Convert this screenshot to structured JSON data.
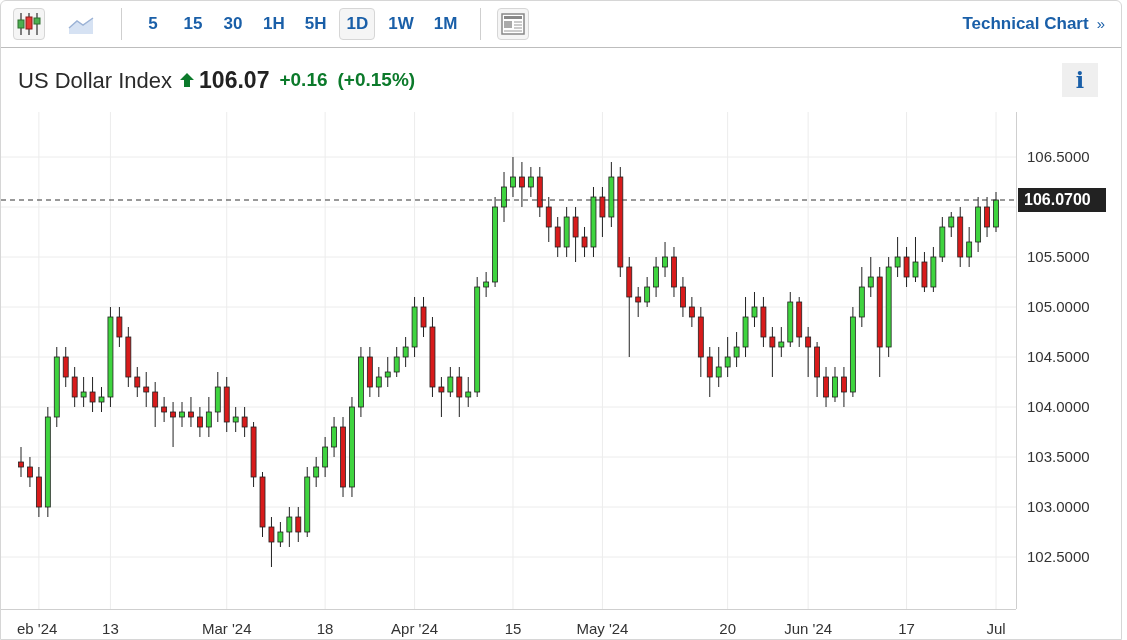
{
  "toolbar": {
    "chart_types": [
      {
        "kind": "candles",
        "selected": true
      },
      {
        "kind": "area",
        "selected": false
      }
    ],
    "intervals": [
      {
        "label": "5",
        "selected": false
      },
      {
        "label": "15",
        "selected": false
      },
      {
        "label": "30",
        "selected": false
      },
      {
        "label": "1H",
        "selected": false
      },
      {
        "label": "5H",
        "selected": false
      },
      {
        "label": "1D",
        "selected": true
      },
      {
        "label": "1W",
        "selected": false
      },
      {
        "label": "1M",
        "selected": false
      }
    ],
    "technical_chart_link": "Technical Chart",
    "link_arrow": "»"
  },
  "quote": {
    "name": "US Dollar Index",
    "rising": true,
    "price": "106.07",
    "change": "+0.16",
    "change_percent": "(+0.15%)",
    "info_button": "i"
  },
  "chart": {
    "current_price_label": "106.0700",
    "chart_data": {
      "type": "candlestick",
      "ylim": [
        101.98,
        106.95
      ],
      "grid": true,
      "ref_lines": [
        {
          "axis": "y",
          "value": 106.07
        }
      ],
      "categories": [
        null,
        null,
        "eb '24",
        null,
        null,
        null,
        null,
        null,
        null,
        null,
        "13",
        null,
        null,
        null,
        null,
        null,
        null,
        null,
        null,
        null,
        null,
        null,
        null,
        "Mar '24",
        null,
        null,
        null,
        null,
        null,
        null,
        null,
        null,
        null,
        null,
        "18",
        null,
        null,
        null,
        null,
        null,
        null,
        null,
        null,
        null,
        "Apr '24",
        null,
        null,
        null,
        null,
        null,
        null,
        null,
        null,
        null,
        null,
        "15",
        null,
        null,
        null,
        null,
        null,
        null,
        null,
        null,
        null,
        "May '24",
        null,
        null,
        null,
        null,
        null,
        null,
        null,
        null,
        null,
        null,
        null,
        null,
        null,
        "20",
        null,
        null,
        null,
        null,
        null,
        null,
        null,
        null,
        "Jun '24",
        null,
        null,
        null,
        null,
        null,
        null,
        null,
        null,
        null,
        null,
        "17",
        null,
        null,
        null,
        null,
        null,
        null,
        null,
        null,
        null,
        "Jul"
      ],
      "ohlc": [
        [
          103.45,
          103.6,
          103.3,
          103.4
        ],
        [
          103.4,
          103.5,
          103.2,
          103.3
        ],
        [
          103.3,
          103.4,
          102.9,
          103.0
        ],
        [
          103.0,
          104.0,
          102.9,
          103.9
        ],
        [
          103.9,
          104.6,
          103.8,
          104.5
        ],
        [
          104.5,
          104.6,
          104.2,
          104.3
        ],
        [
          104.3,
          104.4,
          104.0,
          104.1
        ],
        [
          104.1,
          104.3,
          104.0,
          104.15
        ],
        [
          104.15,
          104.3,
          103.95,
          104.05
        ],
        [
          104.05,
          104.2,
          103.95,
          104.1
        ],
        [
          104.1,
          105.0,
          104.0,
          104.9
        ],
        [
          104.9,
          105.0,
          104.6,
          104.7
        ],
        [
          104.7,
          104.8,
          104.2,
          104.3
        ],
        [
          104.3,
          104.4,
          104.1,
          104.2
        ],
        [
          104.2,
          104.35,
          104.0,
          104.15
        ],
        [
          104.15,
          104.25,
          103.8,
          104.0
        ],
        [
          104.0,
          104.1,
          103.85,
          103.95
        ],
        [
          103.95,
          104.05,
          103.6,
          103.9
        ],
        [
          103.9,
          104.05,
          103.8,
          103.95
        ],
        [
          103.95,
          104.1,
          103.8,
          103.9
        ],
        [
          103.9,
          104.0,
          103.7,
          103.8
        ],
        [
          103.8,
          104.1,
          103.7,
          103.95
        ],
        [
          103.95,
          104.35,
          103.85,
          104.2
        ],
        [
          104.2,
          104.3,
          103.75,
          103.85
        ],
        [
          103.85,
          104.0,
          103.75,
          103.9
        ],
        [
          103.9,
          104.0,
          103.7,
          103.8
        ],
        [
          103.8,
          103.85,
          103.2,
          103.3
        ],
        [
          103.3,
          103.35,
          102.7,
          102.8
        ],
        [
          102.8,
          102.9,
          102.4,
          102.65
        ],
        [
          102.65,
          102.85,
          102.6,
          102.75
        ],
        [
          102.75,
          103.0,
          102.6,
          102.9
        ],
        [
          102.9,
          103.0,
          102.65,
          102.75
        ],
        [
          102.75,
          103.4,
          102.7,
          103.3
        ],
        [
          103.3,
          103.5,
          103.2,
          103.4
        ],
        [
          103.4,
          103.7,
          103.3,
          103.6
        ],
        [
          103.6,
          103.9,
          103.5,
          103.8
        ],
        [
          103.8,
          103.9,
          103.1,
          103.2
        ],
        [
          103.2,
          104.1,
          103.1,
          104.0
        ],
        [
          104.0,
          104.6,
          103.9,
          104.5
        ],
        [
          104.5,
          104.6,
          104.1,
          104.2
        ],
        [
          104.2,
          104.4,
          104.1,
          104.3
        ],
        [
          104.3,
          104.5,
          104.2,
          104.35
        ],
        [
          104.35,
          104.6,
          104.3,
          104.5
        ],
        [
          104.5,
          104.7,
          104.4,
          104.6
        ],
        [
          104.6,
          105.1,
          104.5,
          105.0
        ],
        [
          105.0,
          105.1,
          104.7,
          104.8
        ],
        [
          104.8,
          104.9,
          104.1,
          104.2
        ],
        [
          104.2,
          104.3,
          103.9,
          104.15
        ],
        [
          104.15,
          104.4,
          104.1,
          104.3
        ],
        [
          104.3,
          104.4,
          103.9,
          104.1
        ],
        [
          104.1,
          104.3,
          104.0,
          104.15
        ],
        [
          104.15,
          105.3,
          104.1,
          105.2
        ],
        [
          105.2,
          105.35,
          105.1,
          105.25
        ],
        [
          105.25,
          106.1,
          105.2,
          106.0
        ],
        [
          106.0,
          106.35,
          105.85,
          106.2
        ],
        [
          106.2,
          106.5,
          106.1,
          106.3
        ],
        [
          106.3,
          106.45,
          106.0,
          106.2
        ],
        [
          106.2,
          106.4,
          106.1,
          106.3
        ],
        [
          106.3,
          106.4,
          105.9,
          106.0
        ],
        [
          106.0,
          106.1,
          105.65,
          105.8
        ],
        [
          105.8,
          105.9,
          105.5,
          105.6
        ],
        [
          105.6,
          106.0,
          105.5,
          105.9
        ],
        [
          105.9,
          106.0,
          105.45,
          105.7
        ],
        [
          105.7,
          105.8,
          105.5,
          105.6
        ],
        [
          105.6,
          106.2,
          105.5,
          106.1
        ],
        [
          106.1,
          106.2,
          105.7,
          105.9
        ],
        [
          105.9,
          106.45,
          105.8,
          106.3
        ],
        [
          106.3,
          106.4,
          105.3,
          105.4
        ],
        [
          105.4,
          105.5,
          104.5,
          105.1
        ],
        [
          105.1,
          105.2,
          104.9,
          105.05
        ],
        [
          105.05,
          105.3,
          105.0,
          105.2
        ],
        [
          105.2,
          105.5,
          105.1,
          105.4
        ],
        [
          105.4,
          105.65,
          105.3,
          105.5
        ],
        [
          105.5,
          105.6,
          105.1,
          105.2
        ],
        [
          105.2,
          105.3,
          104.9,
          105.0
        ],
        [
          105.0,
          105.1,
          104.8,
          104.9
        ],
        [
          104.9,
          105.0,
          104.3,
          104.5
        ],
        [
          104.5,
          104.6,
          104.1,
          104.3
        ],
        [
          104.3,
          104.6,
          104.2,
          104.4
        ],
        [
          104.4,
          104.7,
          104.3,
          104.5
        ],
        [
          104.5,
          104.75,
          104.4,
          104.6
        ],
        [
          104.6,
          105.1,
          104.5,
          104.9
        ],
        [
          104.9,
          105.15,
          104.8,
          105.0
        ],
        [
          105.0,
          105.1,
          104.6,
          104.7
        ],
        [
          104.7,
          104.8,
          104.3,
          104.6
        ],
        [
          104.6,
          104.8,
          104.5,
          104.65
        ],
        [
          104.65,
          105.15,
          104.6,
          105.05
        ],
        [
          105.05,
          105.1,
          104.6,
          104.7
        ],
        [
          104.7,
          104.8,
          104.3,
          104.6
        ],
        [
          104.6,
          104.65,
          104.1,
          104.3
        ],
        [
          104.3,
          104.4,
          104.0,
          104.1
        ],
        [
          104.1,
          104.4,
          104.05,
          104.3
        ],
        [
          104.3,
          104.4,
          104.0,
          104.15
        ],
        [
          104.15,
          105.0,
          104.1,
          104.9
        ],
        [
          104.9,
          105.4,
          104.8,
          105.2
        ],
        [
          105.2,
          105.5,
          105.1,
          105.3
        ],
        [
          105.3,
          105.4,
          104.3,
          104.6
        ],
        [
          104.6,
          105.5,
          104.5,
          105.4
        ],
        [
          105.4,
          105.7,
          105.3,
          105.5
        ],
        [
          105.5,
          105.6,
          105.2,
          105.3
        ],
        [
          105.3,
          105.7,
          105.25,
          105.45
        ],
        [
          105.45,
          105.55,
          105.15,
          105.2
        ],
        [
          105.2,
          105.6,
          105.15,
          105.5
        ],
        [
          105.5,
          105.9,
          105.45,
          105.8
        ],
        [
          105.8,
          105.95,
          105.7,
          105.9
        ],
        [
          105.9,
          106.0,
          105.4,
          105.5
        ],
        [
          105.5,
          105.8,
          105.4,
          105.65
        ],
        [
          105.65,
          106.1,
          105.55,
          106.0
        ],
        [
          106.0,
          106.1,
          105.7,
          105.8
        ],
        [
          105.8,
          106.15,
          105.75,
          106.07
        ]
      ],
      "yticks": [
        {
          "value": 106.5,
          "label": "106.5000"
        },
        {
          "value": 105.5,
          "label": "105.5000"
        },
        {
          "value": 105.0,
          "label": "105.0000"
        },
        {
          "value": 104.5,
          "label": "104.5000"
        },
        {
          "value": 104.0,
          "label": "104.0000"
        },
        {
          "value": 103.5,
          "label": "103.5000"
        },
        {
          "value": 103.0,
          "label": "103.0000"
        },
        {
          "value": 102.5,
          "label": "102.5000"
        }
      ]
    }
  }
}
